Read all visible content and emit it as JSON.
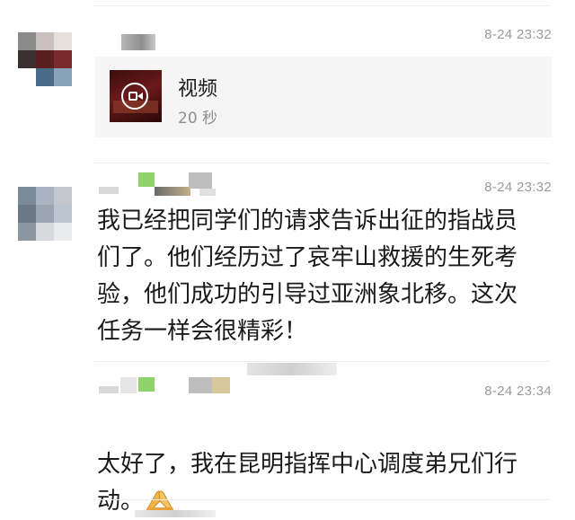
{
  "messages": [
    {
      "timestamp": "8-24 23:32",
      "video": {
        "title": "视频",
        "duration": "20 秒",
        "icon": "video-camera-icon"
      }
    },
    {
      "timestamp": "8-24 23:32",
      "text": "我已经把同学们的请求告诉出征的指战员\n们了。他们经历过了哀牢山救援的生死考\n验，他们成功的引导过亚洲象北移。这次\n任务一样会很精彩！"
    },
    {
      "timestamp": "8-24 23:34",
      "text": "太好了，我在昆明指挥中心调度弟兄们行\n动。",
      "emoji": "folded-hands-icon"
    }
  ],
  "colors": {
    "timestamp": "#9a9a9a",
    "card_bg": "#f5f5f5",
    "divider": "#ededed"
  }
}
